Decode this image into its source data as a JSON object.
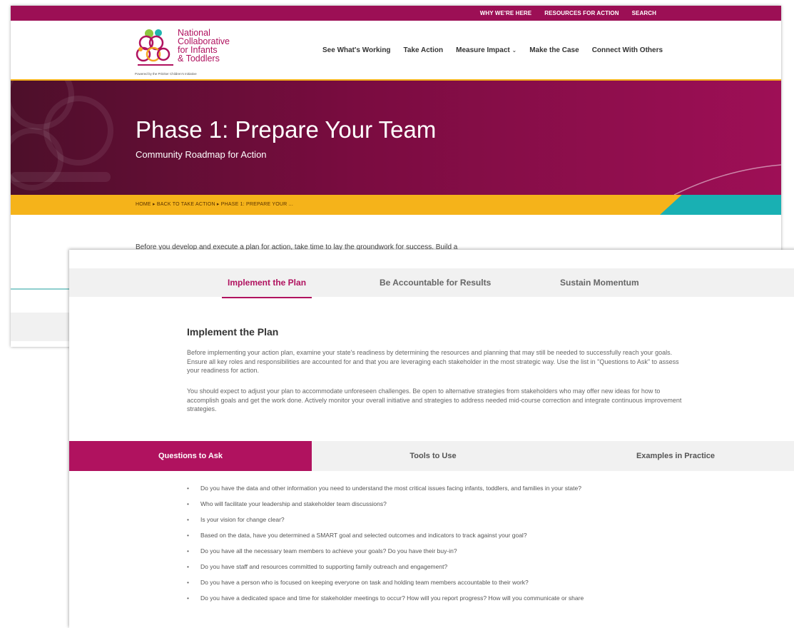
{
  "utility_nav": [
    "WHY WE'RE HERE",
    "RESOURCES FOR ACTION",
    "SEARCH"
  ],
  "logo": {
    "lines": [
      "National",
      "Collaborative",
      "for Infants",
      "& Toddlers"
    ],
    "tagline": "Powered by the Pritzker Children's Initiative"
  },
  "main_nav": {
    "see": "See What's Working",
    "take": "Take Action",
    "measure": "Measure Impact",
    "measure_caret": "⌄",
    "case": "Make the Case",
    "connect": "Connect With Others"
  },
  "hero": {
    "title": "Phase 1: Prepare Your Team",
    "subtitle": "Community Roadmap for Action"
  },
  "breadcrumb": {
    "home": "HOME",
    "back": "BACK TO TAKE ACTION",
    "current": "PHASE 1: PREPARE YOUR ...",
    "sep": "▸"
  },
  "back_intro": "Before you develop and execute a plan for action, take time to lay the groundwork for success. Build a",
  "phase_tabs": [
    "Implement the Plan",
    "Be Accountable for Results",
    "Sustain Momentum"
  ],
  "section": {
    "heading": "Implement the Plan",
    "para1": "Before implementing your action plan, examine your state's readiness by determining the resources and planning that may still be needed to successfully reach your goals. Ensure all key roles and responsibilities are accounted for and that you are leveraging each stakeholder in the most strategic way. Use the list in \"Questions to Ask\" to assess your readiness for action.",
    "para2": "You should expect to adjust your plan to accommodate unforeseen challenges. Be open to alternative strategies from stakeholders who may offer new ideas for how to accomplish goals and get the work done. Actively monitor your overall initiative and strategies to address needed mid-course correction and integrate continuous improvement strategies."
  },
  "resource_tabs": [
    "Questions to Ask",
    "Tools to Use",
    "Examples in Practice"
  ],
  "questions": [
    "Do you have the data and other information you need to understand the most critical issues facing infants, toddlers, and families in your state?",
    "Who will facilitate your leadership and stakeholder team discussions?",
    "Is your vision for change clear?",
    "Based on the data, have you determined a SMART goal and selected outcomes and indicators to track against your goal?",
    "Do you have all the necessary team members to achieve your goals? Do you have their buy-in?",
    "Do you have staff and resources committed to supporting family outreach and engagement?",
    "Do you have a person who is focused on keeping everyone on task and holding team members accountable to their work?",
    "Do you have a dedicated space and time for stakeholder meetings to occur? How will you report progress? How will you communicate or share"
  ],
  "colors": {
    "brand": "#9c0f55",
    "accent_yellow": "#f5b31a",
    "accent_teal": "#19b0b3"
  }
}
